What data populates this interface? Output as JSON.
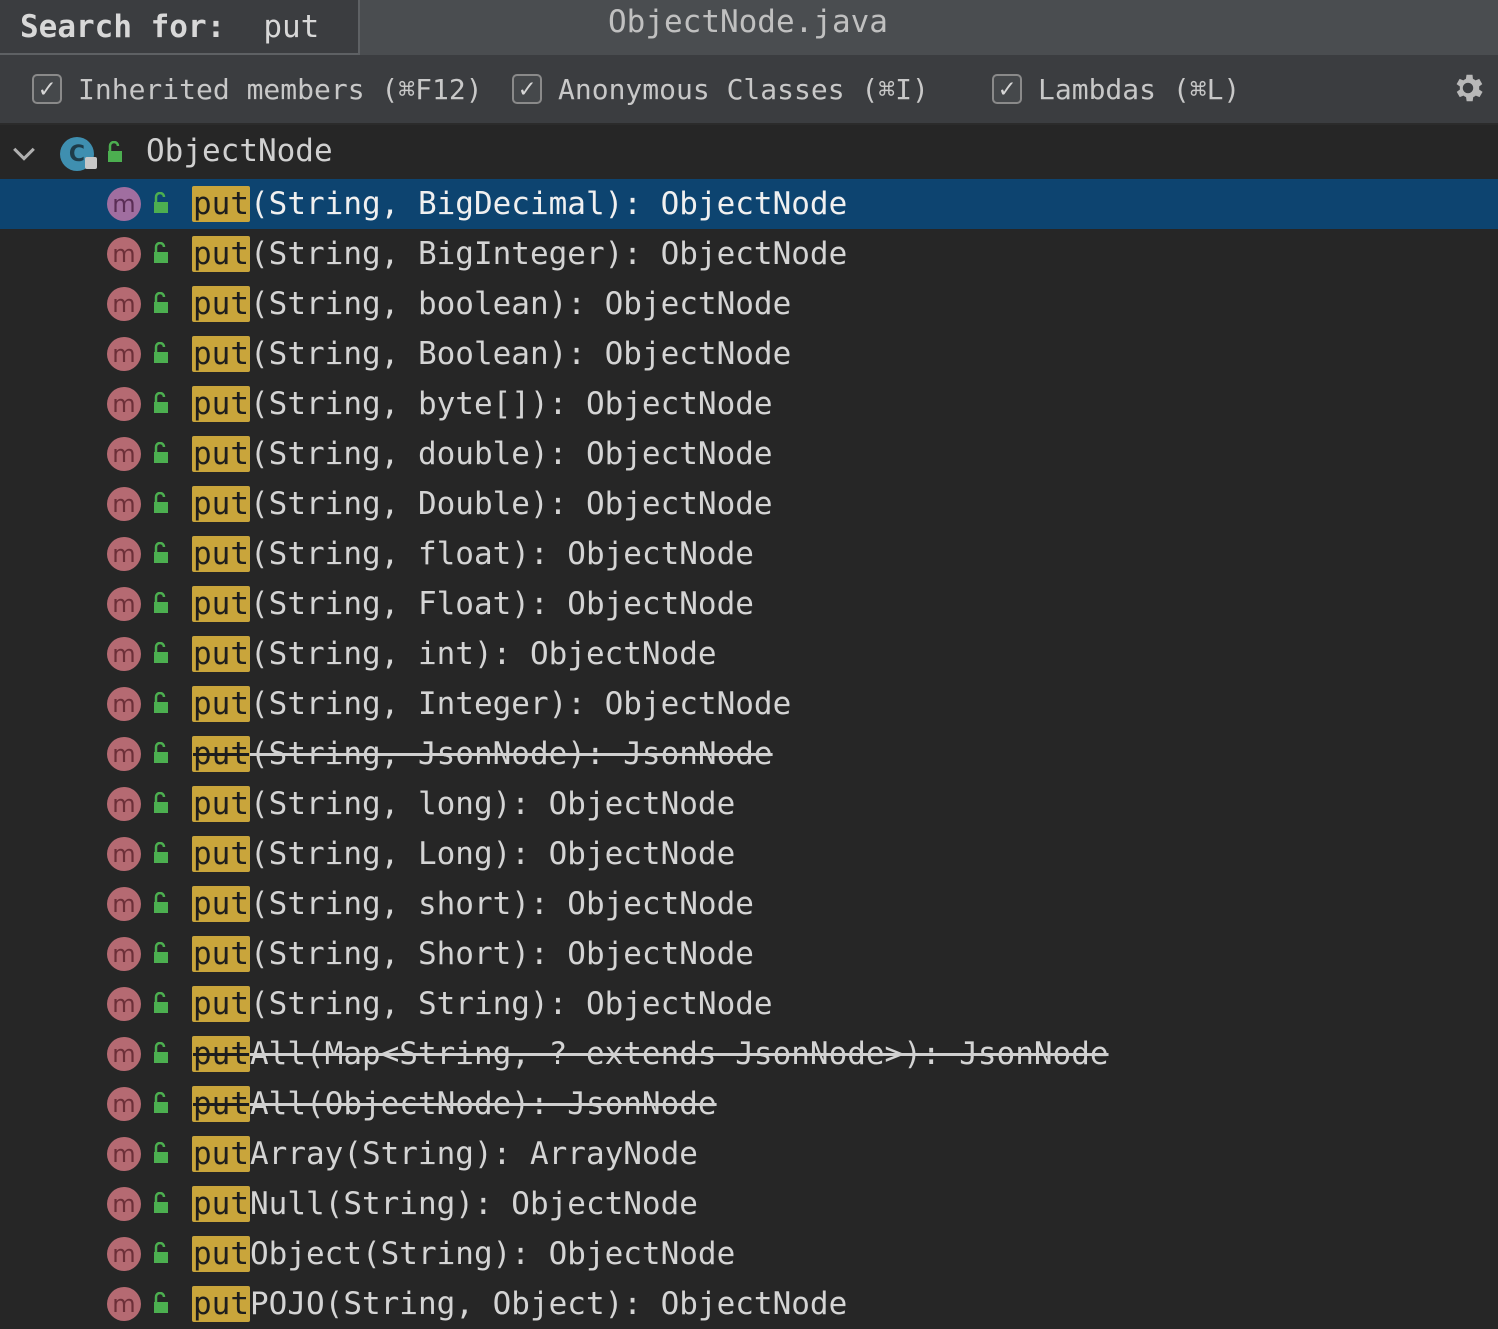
{
  "search": {
    "label": "Search for:",
    "value": "put"
  },
  "file_title": "ObjectNode.java",
  "options": [
    {
      "label": "Inherited members (⌘F12)",
      "checked": true
    },
    {
      "label": "Anonymous Classes (⌘I)",
      "checked": true
    },
    {
      "label": "Lambdas (⌘L)",
      "checked": true
    }
  ],
  "tree": {
    "root": {
      "label": "ObjectNode",
      "icon": "class-icon",
      "icon_letter": "C"
    },
    "method_icon_letter": "m",
    "highlight": "put",
    "items": [
      {
        "match": "put",
        "rest": "(String, BigDecimal): ObjectNode",
        "deprecated": false,
        "selected": true
      },
      {
        "match": "put",
        "rest": "(String, BigInteger): ObjectNode",
        "deprecated": false
      },
      {
        "match": "put",
        "rest": "(String, boolean): ObjectNode",
        "deprecated": false
      },
      {
        "match": "put",
        "rest": "(String, Boolean): ObjectNode",
        "deprecated": false
      },
      {
        "match": "put",
        "rest": "(String, byte[]): ObjectNode",
        "deprecated": false
      },
      {
        "match": "put",
        "rest": "(String, double): ObjectNode",
        "deprecated": false
      },
      {
        "match": "put",
        "rest": "(String, Double): ObjectNode",
        "deprecated": false
      },
      {
        "match": "put",
        "rest": "(String, float): ObjectNode",
        "deprecated": false
      },
      {
        "match": "put",
        "rest": "(String, Float): ObjectNode",
        "deprecated": false
      },
      {
        "match": "put",
        "rest": "(String, int): ObjectNode",
        "deprecated": false
      },
      {
        "match": "put",
        "rest": "(String, Integer): ObjectNode",
        "deprecated": false
      },
      {
        "match": "put",
        "rest": "(String, JsonNode): JsonNode",
        "deprecated": true
      },
      {
        "match": "put",
        "rest": "(String, long): ObjectNode",
        "deprecated": false
      },
      {
        "match": "put",
        "rest": "(String, Long): ObjectNode",
        "deprecated": false
      },
      {
        "match": "put",
        "rest": "(String, short): ObjectNode",
        "deprecated": false
      },
      {
        "match": "put",
        "rest": "(String, Short): ObjectNode",
        "deprecated": false
      },
      {
        "match": "put",
        "rest": "(String, String): ObjectNode",
        "deprecated": false
      },
      {
        "match": "put",
        "rest": "All(Map<String, ? extends JsonNode>): JsonNode",
        "deprecated": true
      },
      {
        "match": "put",
        "rest": "All(ObjectNode): JsonNode",
        "deprecated": true
      },
      {
        "match": "put",
        "rest": "Array(String): ArrayNode",
        "deprecated": false
      },
      {
        "match": "put",
        "rest": "Null(String): ObjectNode",
        "deprecated": false
      },
      {
        "match": "put",
        "rest": "Object(String): ObjectNode",
        "deprecated": false
      },
      {
        "match": "put",
        "rest": "POJO(String, Object): ObjectNode",
        "deprecated": false
      }
    ]
  },
  "colors": {
    "selection": "#0d4470",
    "match_highlight": "#c9a53b",
    "method_icon": "#b56a72",
    "class_icon": "#3f8fb0",
    "access_public": "#4caf50"
  }
}
